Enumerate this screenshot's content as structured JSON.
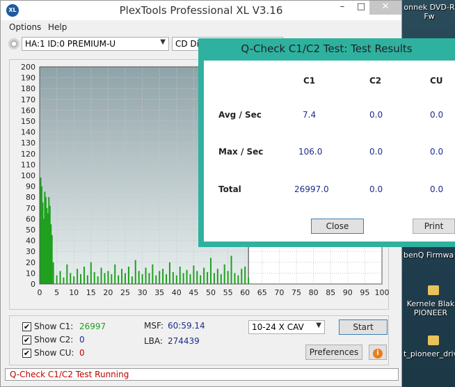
{
  "app": {
    "title": "PlexTools Professional XL V3.16",
    "icon_text": "XL",
    "min_icon": "–",
    "max_icon": "□",
    "close_icon": "✕"
  },
  "menu": [
    "Options",
    "Help"
  ],
  "toolbar": {
    "drive": "HA:1 ID:0  PREMIUM-U",
    "mode": "CD Dia"
  },
  "chart_data": {
    "type": "bar",
    "x_ticks": [
      0,
      5,
      10,
      15,
      20,
      25,
      30,
      35,
      40,
      45,
      50,
      55,
      60,
      65,
      70,
      75,
      80,
      85,
      90,
      95,
      100
    ],
    "y_ticks": [
      0,
      10,
      20,
      30,
      40,
      50,
      60,
      70,
      80,
      90,
      100,
      110,
      120,
      130,
      140,
      150,
      160,
      170,
      180,
      190,
      200
    ],
    "xlim": [
      0,
      100
    ],
    "ylim": [
      0,
      200
    ],
    "progress_x": 61,
    "series": [
      {
        "color": "#1fa01f",
        "x": [
          0.3,
          0.6,
          0.9,
          1.2,
          1.5,
          1.8,
          2.1,
          2.4,
          2.7,
          3.0,
          3.3,
          3.6,
          4.0,
          5,
          6,
          7,
          8,
          9,
          10,
          11,
          12,
          13,
          14,
          15,
          16,
          17,
          18,
          19,
          20,
          21,
          22,
          23,
          24,
          25,
          26,
          27,
          28,
          29,
          30,
          31,
          32,
          33,
          34,
          35,
          36,
          37,
          38,
          39,
          40,
          41,
          42,
          43,
          44,
          45,
          46,
          47,
          48,
          49,
          50,
          51,
          52,
          53,
          54,
          55,
          56,
          57,
          58,
          59,
          60,
          61
        ],
        "y": [
          98,
          90,
          75,
          60,
          85,
          80,
          70,
          65,
          80,
          72,
          55,
          45,
          20,
          8,
          12,
          6,
          18,
          10,
          7,
          14,
          9,
          16,
          8,
          20,
          11,
          7,
          15,
          10,
          12,
          9,
          18,
          8,
          14,
          10,
          16,
          7,
          22,
          12,
          9,
          15,
          10,
          18,
          8,
          12,
          14,
          9,
          20,
          11,
          8,
          16,
          10,
          13,
          9,
          17,
          12,
          8,
          15,
          11,
          24,
          10,
          14,
          9,
          18,
          12,
          26,
          10,
          8,
          14,
          16,
          6
        ]
      }
    ]
  },
  "controls": {
    "show_c1_label": "Show C1:",
    "show_c2_label": "Show C2:",
    "show_cu_label": "Show CU:",
    "c1_count": "26997",
    "c2_count": "0",
    "cu_count": "0",
    "msf_label": "MSF:",
    "msf_value": "60:59.14",
    "lba_label": "LBA:",
    "lba_value": "274439",
    "speed": "10-24 X CAV",
    "start_label": "Start",
    "preferences_label": "Preferences",
    "info_icon": "i",
    "check_mark": "✔",
    "c1_color": "#1fa01f",
    "c2_color": "#1c2c8c",
    "cu_color": "#c00000"
  },
  "status": "Q-Check C1/C2 Test Running",
  "dialog": {
    "title": "Q-Check C1/C2 Test: Test Results",
    "headers": [
      "C1",
      "C2",
      "CU"
    ],
    "rows": [
      {
        "label": "Avg / Sec",
        "c1": "7.4",
        "c2": "0.0",
        "cu": "0.0"
      },
      {
        "label": "Max / Sec",
        "c1": "106.0",
        "c2": "0.0",
        "cu": "0.0"
      },
      {
        "label": "Total",
        "c1": "26997.0",
        "c2": "0.0",
        "cu": "0.0"
      }
    ],
    "close_label": "Close",
    "print_label": "Print"
  },
  "desktop": {
    "item1": "onnek DVD-R\nFw",
    "item2": "benQ Firmwa",
    "item3": "Kernele Blak\nPIONEER",
    "item4": "t_pioneer_driv"
  }
}
